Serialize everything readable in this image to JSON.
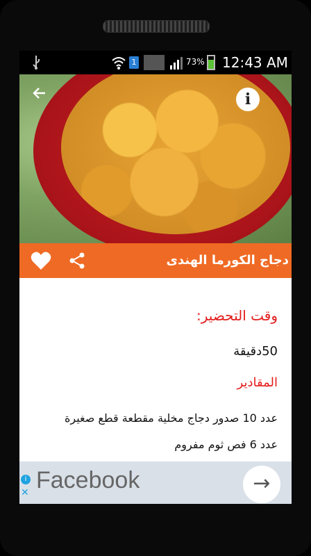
{
  "statusbar": {
    "sim_slot": "1",
    "battery_pct": "73%",
    "battery_level": 0.73,
    "time": "12:43 AM"
  },
  "hero": {
    "back_icon": "arrow-left-icon",
    "info_glyph": "i"
  },
  "recipe": {
    "title": "دجاج الكورما الهندى",
    "prep_label": "وقت التحضير:",
    "prep_value": "50دقيقة",
    "ingredients_label": "المقادير",
    "ingredients": [
      "عدد 10 صدور دجاج مخلية مقطعة قطع صغيرة",
      "عدد 6 فص ثوم مفروم"
    ]
  },
  "ad": {
    "text": "Facebook",
    "info_glyph": "i",
    "close_glyph": "✕",
    "arrow_glyph": "→"
  },
  "colors": {
    "accent": "#ef6a24",
    "label_red": "#e41b1b",
    "ad_bg": "#d9e0e8"
  }
}
